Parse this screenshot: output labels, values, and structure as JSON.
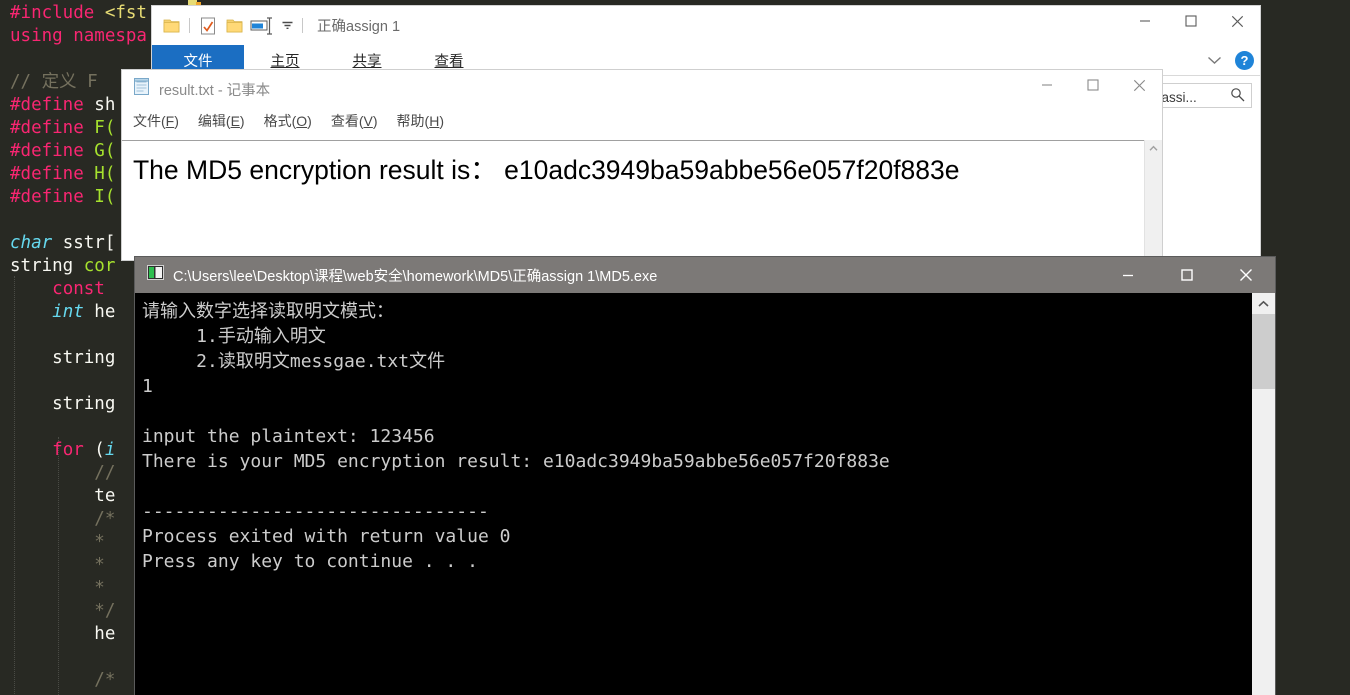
{
  "editor": {
    "lines": [
      [
        {
          "t": "#include ",
          "c": "kw"
        },
        {
          "t": "<fst",
          "c": "str"
        }
      ],
      [
        {
          "t": "using namespa",
          "c": "kw"
        }
      ],
      [],
      [
        {
          "t": "// 定义 F",
          "c": "cm"
        }
      ],
      [
        {
          "t": "#define ",
          "c": "kw"
        },
        {
          "t": "sh",
          "c": "txt"
        }
      ],
      [
        {
          "t": "#define ",
          "c": "kw"
        },
        {
          "t": "F(",
          "c": "fn"
        }
      ],
      [
        {
          "t": "#define ",
          "c": "kw"
        },
        {
          "t": "G(",
          "c": "fn"
        }
      ],
      [
        {
          "t": "#define ",
          "c": "kw"
        },
        {
          "t": "H(",
          "c": "fn"
        }
      ],
      [
        {
          "t": "#define ",
          "c": "kw"
        },
        {
          "t": "I(",
          "c": "fn"
        }
      ],
      [],
      [
        {
          "t": "char",
          "c": "kw2"
        },
        {
          "t": " sstr[",
          "c": "txt"
        }
      ],
      [
        {
          "t": "string ",
          "c": "txt"
        },
        {
          "t": "cor",
          "c": "fn"
        }
      ],
      [
        {
          "t": "    ",
          "c": "txt"
        },
        {
          "t": "const",
          "c": "kw"
        }
      ],
      [
        {
          "t": "    ",
          "c": "txt"
        },
        {
          "t": "int",
          "c": "kw2"
        },
        {
          "t": " he",
          "c": "txt"
        }
      ],
      [],
      [
        {
          "t": "    string",
          "c": "txt"
        }
      ],
      [],
      [
        {
          "t": "    string",
          "c": "txt"
        }
      ],
      [],
      [
        {
          "t": "    ",
          "c": "txt"
        },
        {
          "t": "for",
          "c": "kw"
        },
        {
          "t": " (",
          "c": "txt"
        },
        {
          "t": "i",
          "c": "kw2"
        }
      ],
      [
        {
          "t": "        //",
          "c": "cm"
        }
      ],
      [
        {
          "t": "        te",
          "c": "txt"
        }
      ],
      [
        {
          "t": "        /*",
          "c": "cm"
        }
      ],
      [
        {
          "t": "        *",
          "c": "cm"
        }
      ],
      [
        {
          "t": "        *",
          "c": "cm"
        }
      ],
      [
        {
          "t": "        *",
          "c": "cm"
        }
      ],
      [
        {
          "t": "        */",
          "c": "cm"
        }
      ],
      [
        {
          "t": "        he",
          "c": "txt"
        }
      ],
      [],
      [
        {
          "t": "        /*",
          "c": "cm"
        }
      ]
    ]
  },
  "explorer": {
    "quick_access": {
      "title": "正确assign 1",
      "icons": [
        "folder-icon",
        "checkmark-document-icon",
        "folder-icon",
        "properties-icon",
        "customize-dropdown-icon"
      ]
    },
    "window_buttons": {
      "minimize": "minimize-icon",
      "maximize": "maximize-icon",
      "close": "close-icon"
    },
    "tabs": [
      {
        "label": "文件",
        "active": true
      },
      {
        "label": "主页",
        "active": false
      },
      {
        "label": "共享",
        "active": false
      },
      {
        "label": "查看",
        "active": false
      }
    ],
    "ribbon_collapse": "chevron-down-icon",
    "help_label": "?",
    "search": {
      "value": "确assi...",
      "icon": "search-icon"
    }
  },
  "notepad": {
    "icon": "notepad-icon",
    "title": "result.txt - 记事本",
    "menu": [
      {
        "label": "文件",
        "accel": "F"
      },
      {
        "label": "编辑",
        "accel": "E"
      },
      {
        "label": "格式",
        "accel": "O"
      },
      {
        "label": "查看",
        "accel": "V"
      },
      {
        "label": "帮助",
        "accel": "H"
      }
    ],
    "window_buttons": {
      "minimize": "minimize-icon",
      "maximize": "maximize-icon",
      "close": "close-icon"
    },
    "content": "The MD5 encryption result is： e10adc3949ba59abbe56e057f20f883e",
    "scroll_up_icon": "scroll-up-arrow-icon"
  },
  "console": {
    "icon": "console-app-icon",
    "title": "C:\\Users\\lee\\Desktop\\课程\\web安全\\homework\\MD5\\正确assign 1\\MD5.exe",
    "window_buttons": {
      "minimize": "minimize-icon",
      "maximize": "maximize-icon",
      "close": "close-icon"
    },
    "output": "请输入数字选择读取明文模式：\n     1.手动输入明文\n     2.读取明文messgae.txt文件\n1\n\ninput the plaintext: 123456\nThere is your MD5 encryption result: e10adc3949ba59abbe56e057f20f883e\n\n--------------------------------\nProcess exited with return value 0\nPress any key to continue . . .",
    "scroll_up_icon": "scroll-up-arrow-icon"
  }
}
